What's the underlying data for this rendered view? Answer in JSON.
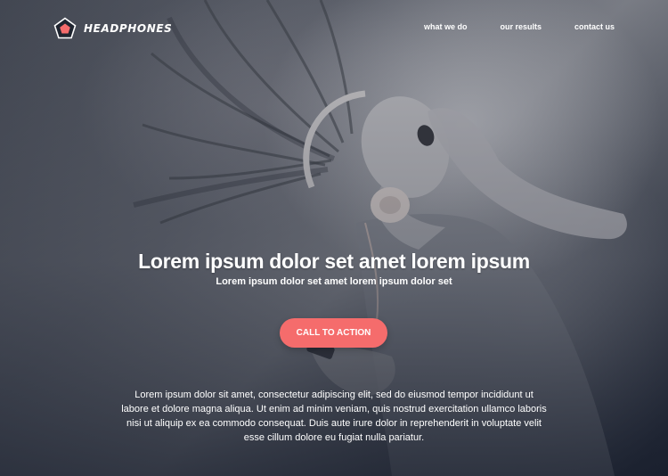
{
  "brand": {
    "name": "HEADPHONES",
    "icon": "pentagon-logo-icon",
    "accent": "#f56c6c"
  },
  "nav": {
    "items": [
      {
        "label": "what we do"
      },
      {
        "label": "our results"
      },
      {
        "label": "contact us"
      }
    ]
  },
  "hero": {
    "headline": "Lorem ipsum dolor set amet lorem ipsum",
    "subheadline": "Lorem ipsum dolor set amet lorem ipsum dolor set",
    "cta_label": "CALL TO ACTION",
    "body": "Lorem ipsum dolor sit amet, consectetur adipiscing elit, sed do eiusmod tempor incididunt ut labore et dolore magna aliqua. Ut enim ad minim veniam, quis nostrud exercitation ullamco laboris nisi ut aliquip ex ea commodo consequat. Duis aute irure dolor in reprehenderit in voluptate velit esse cillum dolore eu fugiat nulla pariatur."
  }
}
